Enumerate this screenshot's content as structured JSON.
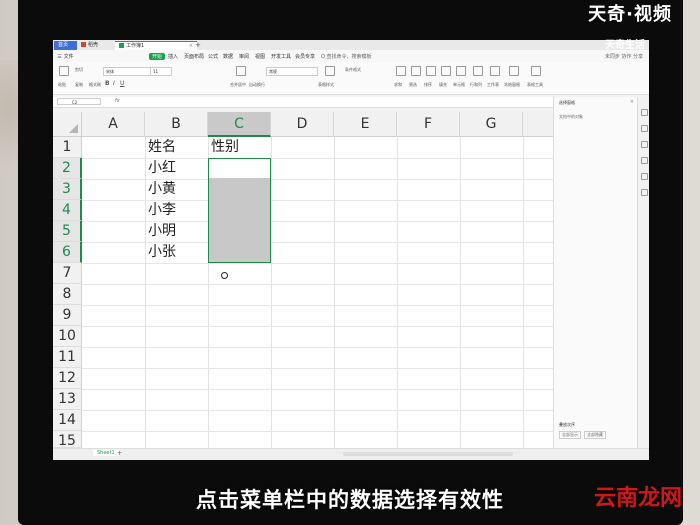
{
  "watermarks": {
    "top_right": "天奇·视频",
    "logo": "天奇生活",
    "brand": "云南龙网"
  },
  "subtitle": "点击菜单栏中的数据选择有效性",
  "app": {
    "tabs": [
      {
        "label": "首页"
      },
      {
        "label": "稻壳"
      },
      {
        "label": "工作簿1"
      }
    ],
    "menu": [
      "三 文件",
      "开始",
      "插入",
      "页面布局",
      "公式",
      "数据",
      "审阅",
      "视图",
      "开发工具",
      "会员专享"
    ],
    "search_label": "Q 查找命令、搜索模板",
    "menu_right": "未同步  协作  分享",
    "ribbon": {
      "font_name": "宋体",
      "font_size": "11",
      "number_format": "常规",
      "paste_label": "粘贴",
      "cut_label": "剪切",
      "copy_label": "复制",
      "format_painter_label": "格式刷",
      "merge_label": "合并居中",
      "wrap_label": "自动换行",
      "conditional_label": "条件格式",
      "table_style_label": "表格样式",
      "sum_label": "求和",
      "filter_label": "筛选",
      "sort_label": "排序",
      "fill_label": "填充",
      "cell_label": "单元格",
      "row_col_label": "行和列",
      "sheet_label": "工作表",
      "freeze_label": "冻结窗格",
      "tools_label": "表格工具"
    },
    "name_box": "C2",
    "fx_label": "fx"
  },
  "grid": {
    "columns": [
      "A",
      "B",
      "C",
      "D",
      "E",
      "F",
      "G"
    ],
    "rows": [
      "1",
      "2",
      "3",
      "4",
      "5",
      "6",
      "7",
      "8",
      "9",
      "10",
      "11",
      "12",
      "13",
      "14",
      "15"
    ],
    "cells": {
      "B1": "姓名",
      "C1": "性别",
      "B2": "小红",
      "B3": "小黄",
      "B4": "小李",
      "B5": "小明",
      "B6": "小张"
    }
  },
  "sheets": [
    "Sheet1"
  ],
  "pane": {
    "title": "选择窗格",
    "subtitle": "文档中的对象",
    "count_label": "叠放次序",
    "show_all": "全部显示",
    "hide_all": "全部隐藏"
  }
}
